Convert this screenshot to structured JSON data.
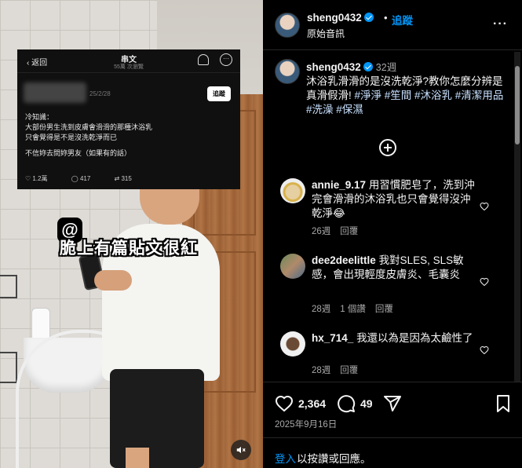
{
  "colors": {
    "background": "#000000",
    "link": "#0095f6",
    "verified": "#0095f6",
    "muted_text": "#a8a8a8"
  },
  "header": {
    "username": "sheng0432",
    "dot": "•",
    "follow_label": "追蹤",
    "subtitle": "原始音訊",
    "more_icon": "more-horizontal-icon"
  },
  "post": {
    "username": "sheng0432",
    "time": "32週",
    "caption": "沐浴乳滑滑的是沒洗乾淨?教你怎麼分辨是真滑假滑!",
    "hashtags": "#淨淨 #笙間 #沐浴乳 #清潔用品 #洗澡 #保濕"
  },
  "comments": [
    {
      "user": "annie_9.17",
      "text": "用習慣肥皂了，洗到沖完會滑滑的沐浴乳也只會覺得沒沖乾淨😂",
      "time": "26週",
      "reply": "回覆",
      "replies_link": ""
    },
    {
      "user": "dee2deelittle",
      "text": "我對SLES, SLS敏感，會出現輕度皮膚炎、毛囊炎",
      "time": "28週",
      "reply": "1 個讚",
      "replies_link": "回覆"
    },
    {
      "user": "hx_714_",
      "text": "我還以為是因為太鹼性了",
      "time": "28週",
      "reply": "回覆",
      "replies_link": ""
    }
  ],
  "actions": {
    "likes": "2,364",
    "comments": "49",
    "date": "2025年9月16日"
  },
  "login": {
    "link": "登入",
    "text": "以按讚或回應。"
  },
  "video": {
    "caption_overlay": "脆上有篇貼文很紅",
    "threads_card": {
      "back_label": "返回",
      "title": "串文",
      "subtitle": "55萬 次瀏覽",
      "date": "25/2/28",
      "follow_label": "追蹤",
      "body_lines": [
        "冷知識：",
        "大部份男生洗到皮膚會滑滑的那種沐浴乳",
        "只會覺得是不是沒洗乾淨而已",
        "",
        "不信妳去問妳男友（如果有的話）"
      ],
      "likes": "1.2萬",
      "comments": "417",
      "reposts": "315"
    }
  }
}
